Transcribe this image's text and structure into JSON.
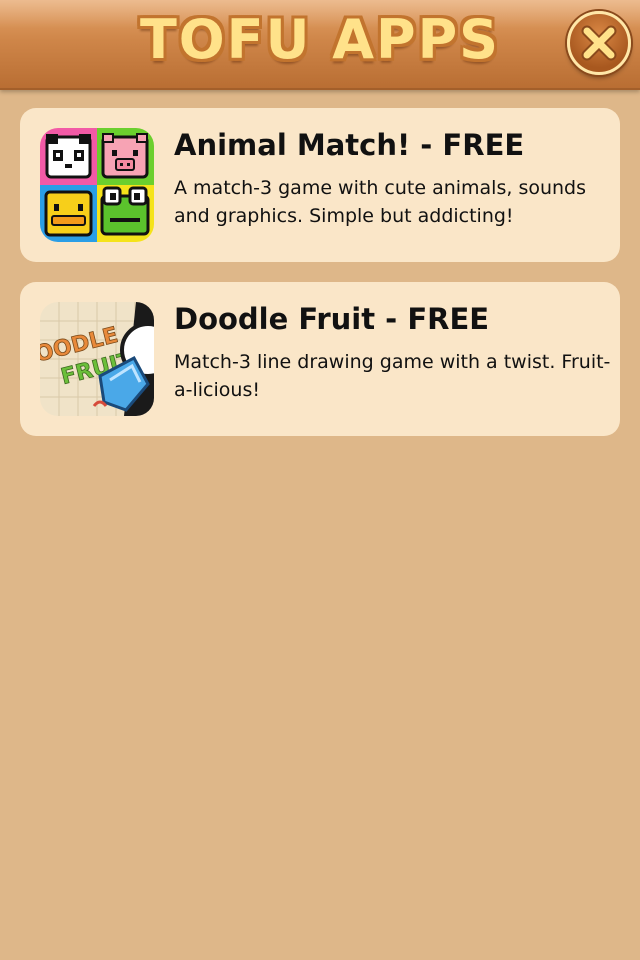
{
  "header": {
    "title": "TOFU APPS",
    "close_icon": "close-x-icon"
  },
  "apps": [
    {
      "title": "Animal Match! - FREE",
      "description": "A match-3 game with cute animals, sounds and graphics. Simple but addicting!",
      "icon": "animal-match-app-icon"
    },
    {
      "title": "Doodle Fruit - FREE",
      "description": "Match-3 line drawing game with a twist. Fruit-a-licious!",
      "icon": "doodle-fruit-app-icon",
      "icon_text": "DOODLE FRUIT"
    }
  ],
  "colors": {
    "background": "#deb789",
    "header": "#cf8649",
    "card": "#fae6c8",
    "title_fill": "#ffe28a"
  }
}
